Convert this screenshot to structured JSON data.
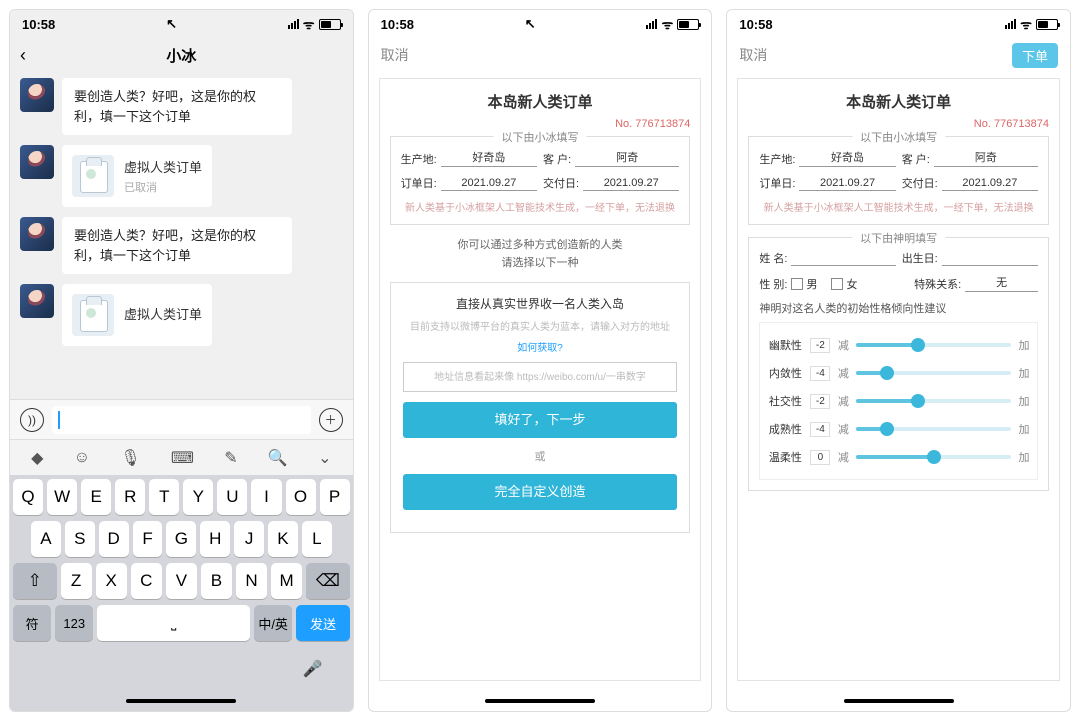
{
  "status": {
    "time": "10:58"
  },
  "chat": {
    "title": "小冰",
    "messages": [
      {
        "type": "text",
        "text": "要创造人类？好吧，这是你的权利，填一下这个订单"
      },
      {
        "type": "card",
        "title": "虚拟人类订单",
        "sub": "已取消"
      },
      {
        "type": "text",
        "text": "要创造人类？好吧，这是你的权利，填一下这个订单"
      },
      {
        "type": "card",
        "title": "虚拟人类订单",
        "sub": ""
      }
    ],
    "keyboard": {
      "row1": [
        "Q",
        "W",
        "E",
        "R",
        "T",
        "Y",
        "U",
        "I",
        "O",
        "P"
      ],
      "row2": [
        "A",
        "S",
        "D",
        "F",
        "G",
        "H",
        "J",
        "K",
        "L"
      ],
      "row3_shift": "⇧",
      "row3": [
        "Z",
        "X",
        "C",
        "V",
        "B",
        "N",
        "M"
      ],
      "row3_del": "⌫",
      "row4": {
        "sym": "符",
        "num": "123",
        "space": "",
        "lang": "中/英",
        "send": "发送"
      }
    }
  },
  "form": {
    "cancel": "取消",
    "order_btn": "下单",
    "title": "本岛新人类订单",
    "no_label": "No.",
    "no": "776713874",
    "sect1_label": "以下由小冰填写",
    "fields": {
      "place_l": "生产地:",
      "place_v": "好奇岛",
      "cust_l": "客 户:",
      "cust_v": "阿奇",
      "odate_l": "订单日:",
      "odate_v": "2021.09.27",
      "ddate_l": "交付日:",
      "ddate_v": "2021.09.27"
    },
    "disclaimer": "新人类基于小冰框架人工智能技术生成，一经下单，无法退换",
    "mid_hint1": "你可以通过多种方式创造新的人类",
    "mid_hint2": "请选择以下一种",
    "import_title": "直接从真实世界收一名人类入岛",
    "import_note": "目前支持以微博平台的真实人类为蓝本，请输入对方的地址",
    "import_link": "如何获取?",
    "import_placeholder": "地址信息看起来像 https://weibo.com/u/一串数字",
    "btn_next": "填好了，下一步",
    "or": "或",
    "btn_custom": "完全自定义创造",
    "sect2_label": "以下由神明填写",
    "p3": {
      "name_l": "姓 名:",
      "name_v": "",
      "birth_l": "出生日:",
      "birth_v": "",
      "sex_l": "性 别:",
      "sex_m": "男",
      "sex_f": "女",
      "rel_l": "特殊关系:",
      "rel_v": "无",
      "trait_title": "神明对这名人类的初始性格倾向性建议",
      "minus": "减",
      "plus": "加",
      "traits": [
        {
          "name": "幽默性",
          "val": -2,
          "pct": 40
        },
        {
          "name": "内敛性",
          "val": -4,
          "pct": 20
        },
        {
          "name": "社交性",
          "val": -2,
          "pct": 40
        },
        {
          "name": "成熟性",
          "val": -4,
          "pct": 20
        },
        {
          "name": "温柔性",
          "val": 0,
          "pct": 50
        }
      ]
    }
  }
}
